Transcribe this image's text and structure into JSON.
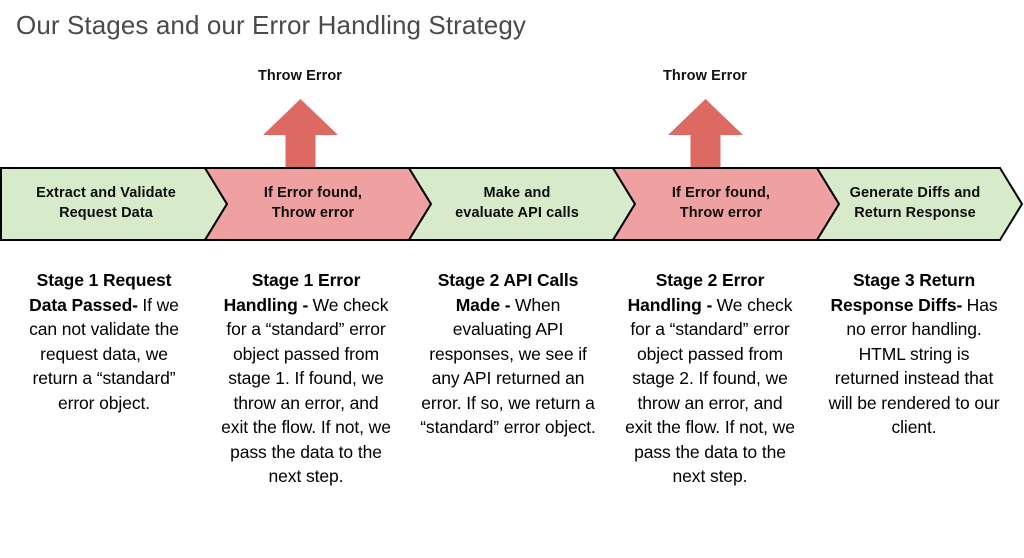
{
  "page": {
    "title": "Our Stages and our Error Handling Strategy",
    "title_color": "#4a4a4a",
    "background": "#ffffff"
  },
  "colors": {
    "green_fill": "#d7ebcb",
    "red_fill": "#efa0a0",
    "arrow_red": "#dd6a62",
    "outline": "#000000",
    "text": "#000000"
  },
  "throw_arrows": [
    {
      "label": "Throw Error",
      "icon": "up-arrow-icon"
    },
    {
      "label": "Throw Error",
      "icon": "up-arrow-icon"
    }
  ],
  "band": {
    "segments": [
      {
        "line1": "Extract and Validate",
        "line2": "Request Data",
        "type": "stage",
        "fill": "#d7ebcb"
      },
      {
        "line1": "If Error found,",
        "line2": "Throw error",
        "type": "error",
        "fill": "#efa0a0"
      },
      {
        "line1": "Make and",
        "line2": "evaluate API calls",
        "type": "stage",
        "fill": "#d7ebcb"
      },
      {
        "line1": "If Error found,",
        "line2": "Throw error",
        "type": "error",
        "fill": "#efa0a0"
      },
      {
        "line1": "Generate Diffs and",
        "line2": "Return Response",
        "type": "stage",
        "fill": "#d7ebcb"
      }
    ]
  },
  "columns": [
    {
      "heading": "Stage 1 Request Data Passed-",
      "body": "If we can not validate the request data, we return a “standard” error object."
    },
    {
      "heading": "Stage 1 Error Handling -",
      "body": "We check for a “standard” error object passed from stage 1. If found, we throw an error, and exit the flow. If not, we pass the data to the next step."
    },
    {
      "heading": "Stage 2 API Calls Made -",
      "body": "When evaluating API responses, we see if any API returned an error. If so, we return a “standard” error object."
    },
    {
      "heading": "Stage 2 Error Handling -",
      "body": "We check for a “standard” error object passed from stage 2. If found, we throw an error, and exit the flow. If not, we pass the data to the next step."
    },
    {
      "heading": "Stage 3 Return Response Diffs-",
      "body": "Has no error handling. HTML string is returned instead that will be rendered to our client."
    }
  ]
}
